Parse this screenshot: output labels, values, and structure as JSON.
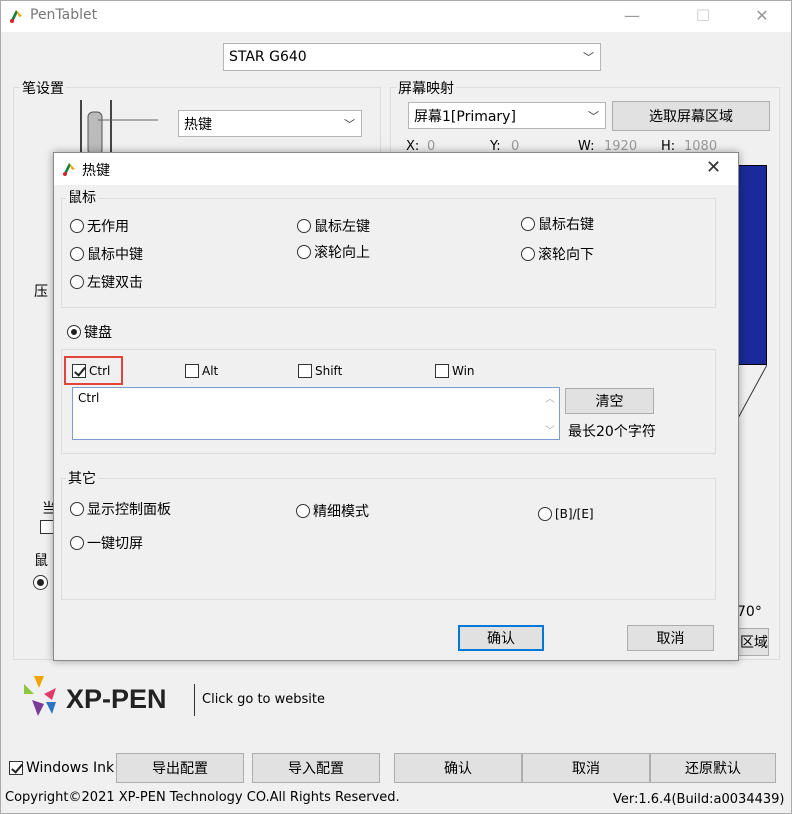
{
  "window": {
    "title": "PenTablet",
    "min": "—",
    "max": "☐",
    "close": "✕"
  },
  "device_select": {
    "value": "STAR G640"
  },
  "pen_settings": {
    "label": "笔设置",
    "button_function": "热键"
  },
  "pressure_label": "压",
  "current_label": "当",
  "mouse_mode_label": "鼠",
  "screen_mapping": {
    "label": "屏幕映射",
    "screen_select": "屏幕1[Primary]",
    "select_area_button": "选取屏幕区域",
    "x_label": "X:",
    "x_value": "0",
    "y_label": "Y:",
    "y_value": "0",
    "w_label": "W:",
    "w_value": "1920",
    "h_label": "H:",
    "h_value": "1080",
    "rotation": "70°",
    "area_button": "区域"
  },
  "hotkey_dialog": {
    "title": "热键",
    "close": "✕",
    "mouse_group": {
      "label": "鼠标",
      "options": [
        "无作用",
        "鼠标左键",
        "鼠标右键",
        "鼠标中键",
        "滚轮向上",
        "滚轮向下",
        "左键双击"
      ]
    },
    "keyboard": {
      "label": "键盘",
      "ctrl": "Ctrl",
      "alt": "Alt",
      "shift": "Shift",
      "win": "Win",
      "input_value": "Ctrl",
      "clear_button": "清空",
      "max_hint": "最长20个字符"
    },
    "other_group": {
      "label": "其它",
      "show_panel": "显示控制面板",
      "fine_mode": "精细模式",
      "b_e": "[B]/[E]",
      "switch_screen": "一键切屏"
    },
    "ok_button": "确认",
    "cancel_button": "取消"
  },
  "brand": {
    "logo_text": "XP-PEN",
    "website_link": "Click go to website"
  },
  "footer": {
    "windows_ink": "Windows Ink",
    "export_button": "导出配置",
    "import_button": "导入配置",
    "ok_button": "确认",
    "cancel_button": "取消",
    "restore_button": "还原默认",
    "copyright": "Copyright©2021 XP-PEN Technology CO.All Rights Reserved.",
    "version": "Ver:1.6.4(Build:a0034439)"
  },
  "colors": {
    "accent": "#0078d7",
    "highlight_box": "#e0443a",
    "map_fill": "#1a2a9a"
  }
}
